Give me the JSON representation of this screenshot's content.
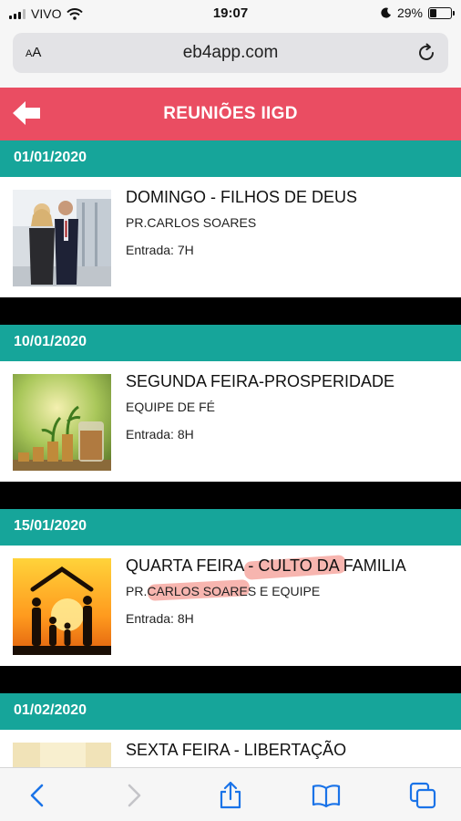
{
  "status_bar": {
    "carrier": "VIVO",
    "time": "19:07",
    "battery": "29%"
  },
  "browser": {
    "text_size_label": "AA",
    "url": "eb4app.com"
  },
  "app": {
    "title": "REUNIÕES IIGD"
  },
  "meetings": [
    {
      "date": "01/01/2020",
      "title": "DOMINGO - FILHOS DE DEUS",
      "leader": "PR.CARLOS SOARES",
      "entry": "Entrada: 7H"
    },
    {
      "date": "10/01/2020",
      "title": "SEGUNDA FEIRA-PROSPERIDADE",
      "leader": "EQUIPE DE FÉ",
      "entry": "Entrada: 8H"
    },
    {
      "date": "15/01/2020",
      "title": "QUARTA FEIRA - CULTO DA FAMILIA",
      "leader": "PR.CARLOS SOARES E EQUIPE",
      "entry": "Entrada: 8H"
    },
    {
      "date": "01/02/2020",
      "title": "SEXTA FEIRA - LIBERTAÇÃO",
      "leader": "",
      "entry": ""
    }
  ],
  "colors": {
    "header": "#ea4d62",
    "date_bar": "#16a59a",
    "browser_accent": "#1a73e8"
  },
  "icons": {
    "back": "back-arrow-icon",
    "reload": "reload-icon",
    "nav_back": "chevron-left-icon",
    "nav_forward": "chevron-right-icon",
    "share": "share-icon",
    "bookmarks": "book-icon",
    "tabs": "tabs-icon"
  }
}
